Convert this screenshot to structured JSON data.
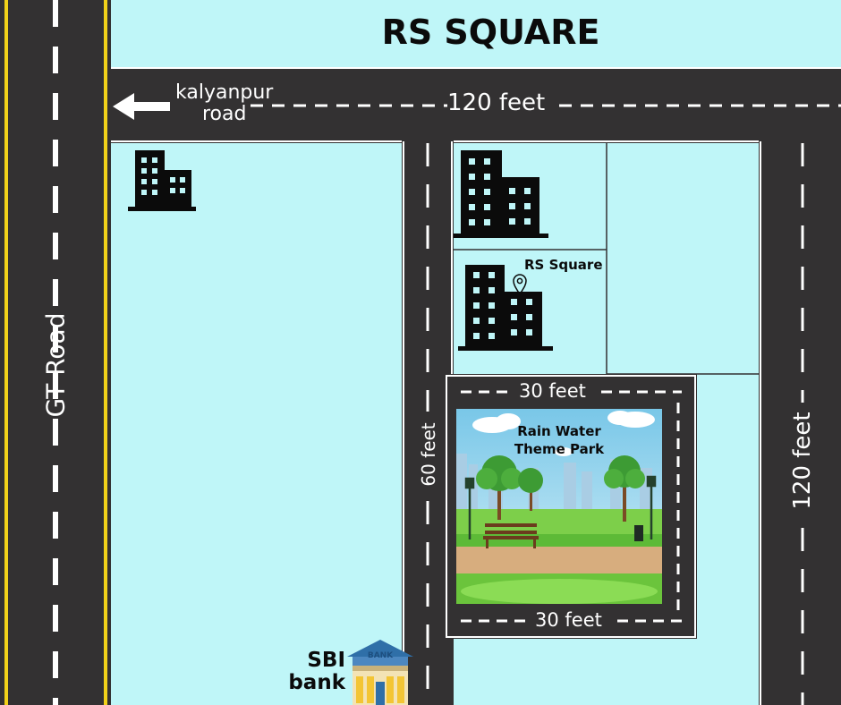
{
  "title": "RS SQUARE",
  "roads": {
    "gt_road": "GT Road",
    "kalyanpur_road": "kalyanpur\nroad",
    "top_width": "120 feet",
    "right_width": "120 feet",
    "middle_width": "60 feet",
    "park_top_width": "30 feet",
    "park_bottom_width": "30 feet"
  },
  "landmarks": {
    "rs_square": "RS Square",
    "park": "Rain Water\nTheme Park",
    "bank_label": "SBI\nbank",
    "bank_sign": "BANK"
  },
  "icons": [
    "building-icon",
    "location-pin-icon",
    "park-illustration",
    "bank-icon",
    "arrow-left-icon"
  ],
  "colors": {
    "background": "#bff6f8",
    "road": "#333132",
    "road_center_yellow": "#f2d21a",
    "road_marking": "#ffffff",
    "building": "#0b0b0b"
  }
}
